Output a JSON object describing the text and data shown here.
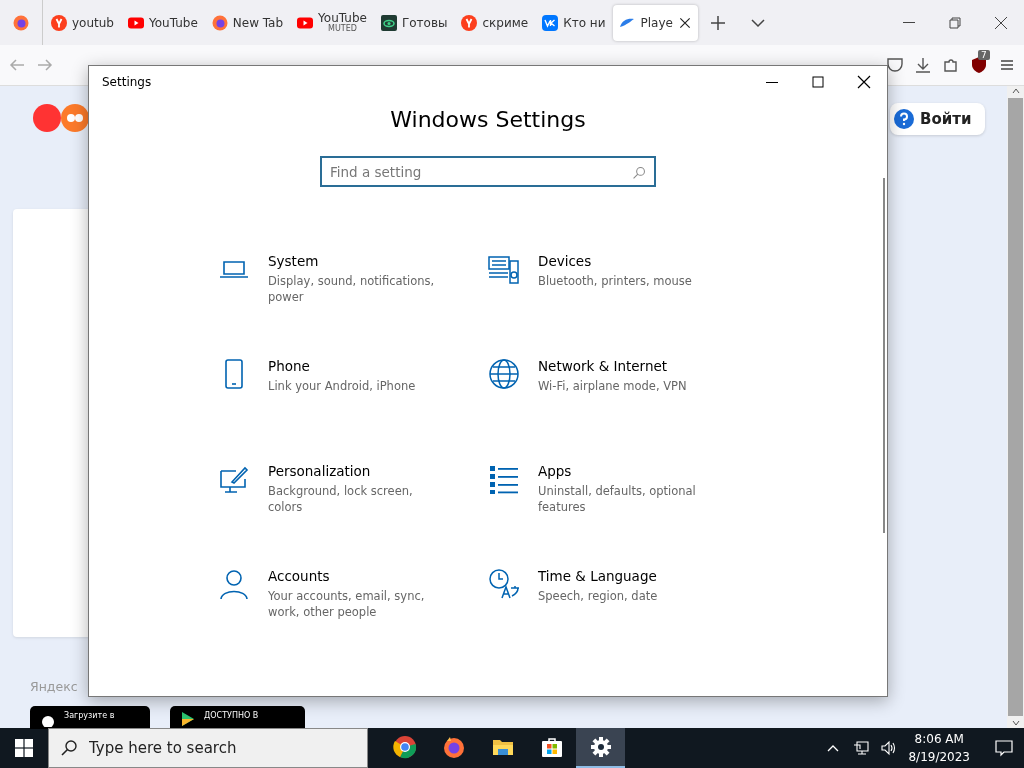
{
  "browser": {
    "tabs": [
      {
        "kind": "yandex",
        "title": "youtub",
        "selected": false
      },
      {
        "kind": "youtube",
        "title": "YouTube",
        "selected": false
      },
      {
        "kind": "firefox",
        "title": "New Tab",
        "selected": false
      },
      {
        "kind": "youtube",
        "title": "YouTube",
        "subtitle": "MUTED",
        "selected": false
      },
      {
        "kind": "green",
        "title": "Готовы",
        "selected": false
      },
      {
        "kind": "yandex",
        "title": "скриме",
        "selected": false
      },
      {
        "kind": "vk",
        "title": "Кто ни",
        "selected": false
      },
      {
        "kind": "cloud",
        "title": "Playe",
        "selected": true
      }
    ],
    "extension_badge": "7",
    "page": {
      "login_button": "Войти",
      "footer_text": "Яндекс",
      "store_badges": [
        {
          "kind": "apple",
          "caption": "Загрузите в"
        },
        {
          "kind": "play",
          "caption": "ДОСТУПНО В"
        }
      ]
    }
  },
  "settings": {
    "window": {
      "title": "Settings"
    },
    "heading": "Windows Settings",
    "search": {
      "placeholder": "Find a setting"
    },
    "items": [
      {
        "kind": "laptop",
        "name": "System",
        "description": "Display, sound, notifications, power"
      },
      {
        "kind": "keyboard",
        "name": "Devices",
        "description": "Bluetooth, printers, mouse"
      },
      {
        "kind": "phone",
        "name": "Phone",
        "description": "Link your Android, iPhone"
      },
      {
        "kind": "globe",
        "name": "Network & Internet",
        "description": "Wi-Fi, airplane mode, VPN"
      },
      {
        "kind": "paint",
        "name": "Personalization",
        "description": "Background, lock screen, colors"
      },
      {
        "kind": "list",
        "name": "Apps",
        "description": "Uninstall, defaults, optional features"
      },
      {
        "kind": "person",
        "name": "Accounts",
        "description": "Your accounts, email, sync, work, other people"
      },
      {
        "kind": "clock",
        "name": "Time & Language",
        "description": "Speech, region, date"
      }
    ]
  },
  "taskbar": {
    "search": {
      "placeholder": "Type here to search"
    },
    "apps": [
      {
        "kind": "chrome",
        "selected": false
      },
      {
        "kind": "firefox",
        "selected": false
      },
      {
        "kind": "folder",
        "selected": false
      },
      {
        "kind": "store",
        "selected": false
      },
      {
        "kind": "gear",
        "selected": true
      }
    ],
    "time": "8:06 AM",
    "date": "8/19/2023"
  }
}
